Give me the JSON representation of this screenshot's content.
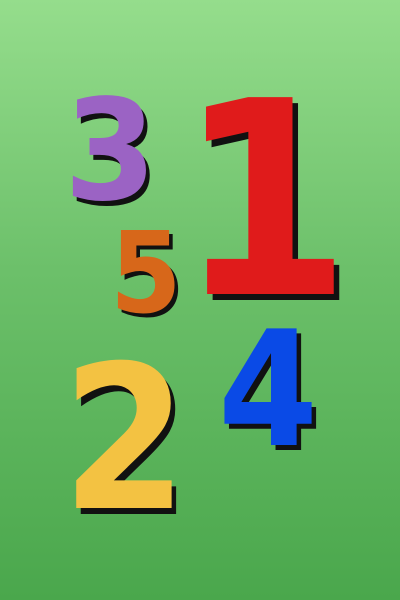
{
  "background": {
    "gradient_top": "#95dd8c",
    "gradient_bottom": "#4aa74c"
  },
  "shadow_color": "#111111",
  "digits": [
    {
      "text": "3",
      "color": "#9b63c4"
    },
    {
      "text": "1",
      "color": "#e01b1b"
    },
    {
      "text": "5",
      "color": "#d7671a"
    },
    {
      "text": "2",
      "color": "#f3c242"
    },
    {
      "text": "4",
      "color": "#0a4ae6"
    }
  ]
}
